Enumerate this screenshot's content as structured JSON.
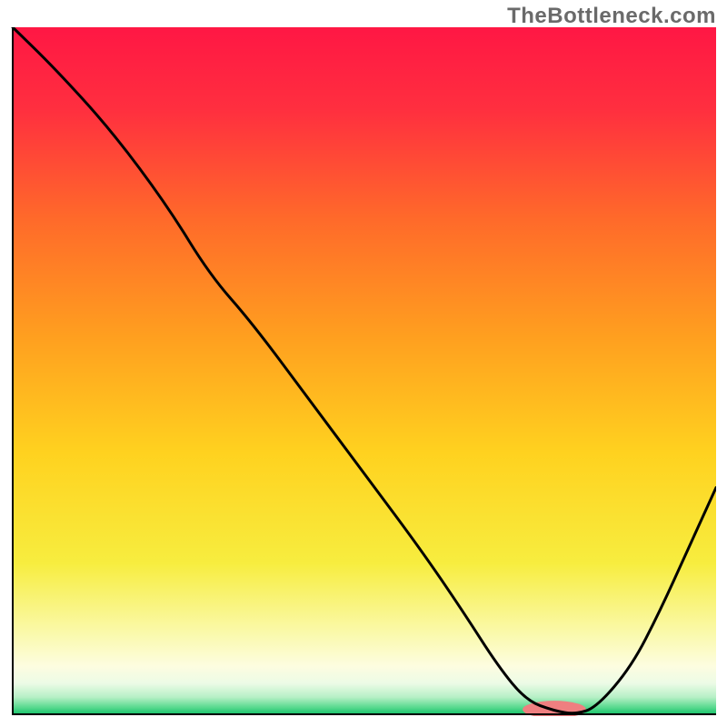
{
  "watermark": "TheBottleneck.com",
  "chart_data": {
    "type": "area",
    "title": "",
    "xlabel": "",
    "ylabel": "",
    "xlim": [
      0,
      100
    ],
    "ylim": [
      0,
      100
    ],
    "grid": false,
    "legend": false,
    "gradient_stops": [
      {
        "offset": 0.0,
        "color": "#ff1744"
      },
      {
        "offset": 0.12,
        "color": "#ff2f3f"
      },
      {
        "offset": 0.28,
        "color": "#ff6a2a"
      },
      {
        "offset": 0.45,
        "color": "#ff9f1f"
      },
      {
        "offset": 0.62,
        "color": "#ffd21f"
      },
      {
        "offset": 0.78,
        "color": "#f7ed3f"
      },
      {
        "offset": 0.88,
        "color": "#faf9a9"
      },
      {
        "offset": 0.93,
        "color": "#fdfde0"
      },
      {
        "offset": 0.955,
        "color": "#ecfbe6"
      },
      {
        "offset": 0.975,
        "color": "#b7f0c6"
      },
      {
        "offset": 0.99,
        "color": "#58d98f"
      },
      {
        "offset": 1.0,
        "color": "#18c26a"
      }
    ],
    "series": [
      {
        "name": "curve",
        "stroke": "#000000",
        "x": [
          0,
          6,
          14,
          22,
          28,
          34,
          42,
          50,
          58,
          64,
          69,
          73,
          77,
          80,
          83,
          88,
          92,
          96,
          100
        ],
        "values": [
          100,
          94,
          85,
          74,
          64,
          57,
          46,
          35,
          24,
          15,
          7,
          2,
          0.5,
          0,
          1,
          7,
          15,
          24,
          33
        ]
      }
    ],
    "marker": {
      "name": "highlight-pill",
      "fill": "#ef7f80",
      "x_center": 77,
      "y_center": 0.7,
      "rx": 4.5,
      "ry": 1.0
    },
    "axes": {
      "color": "#000000",
      "width": 2
    }
  }
}
